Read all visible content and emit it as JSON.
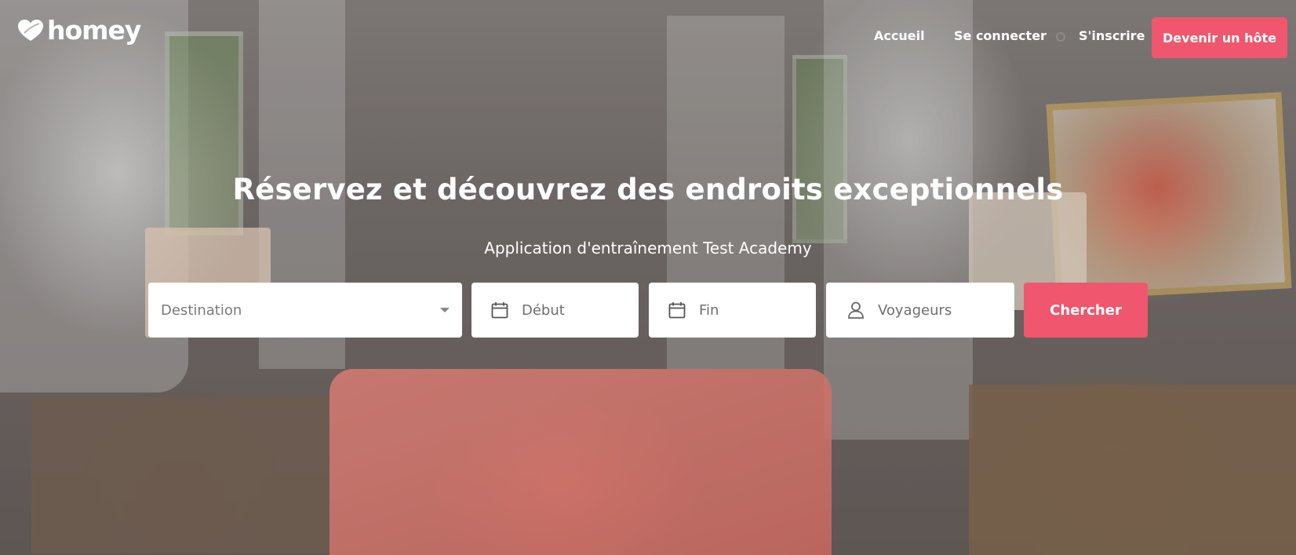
{
  "brand": {
    "logo_text": "homey",
    "logo_icon": "homey-heart-logo-icon",
    "accent_color": "#f0566e"
  },
  "nav": {
    "home_label": "Accueil",
    "login_label": "Se connecter",
    "signup_label": "S'inscrire",
    "host_button_label": "Devenir un hôte"
  },
  "hero": {
    "title": "Réservez et découvrez des endroits exceptionnels",
    "subtitle": "Application d'entraînement Test Academy",
    "background": "bedroom-photo"
  },
  "search": {
    "destination_placeholder": "Destination",
    "start_placeholder": "Début",
    "end_placeholder": "Fin",
    "guests_placeholder": "Voyageurs",
    "search_button_label": "Chercher",
    "start_icon": "calendar-icon",
    "end_icon": "calendar-icon",
    "guests_icon": "user-icon",
    "destination_dropdown_icon": "caret-down-icon"
  }
}
